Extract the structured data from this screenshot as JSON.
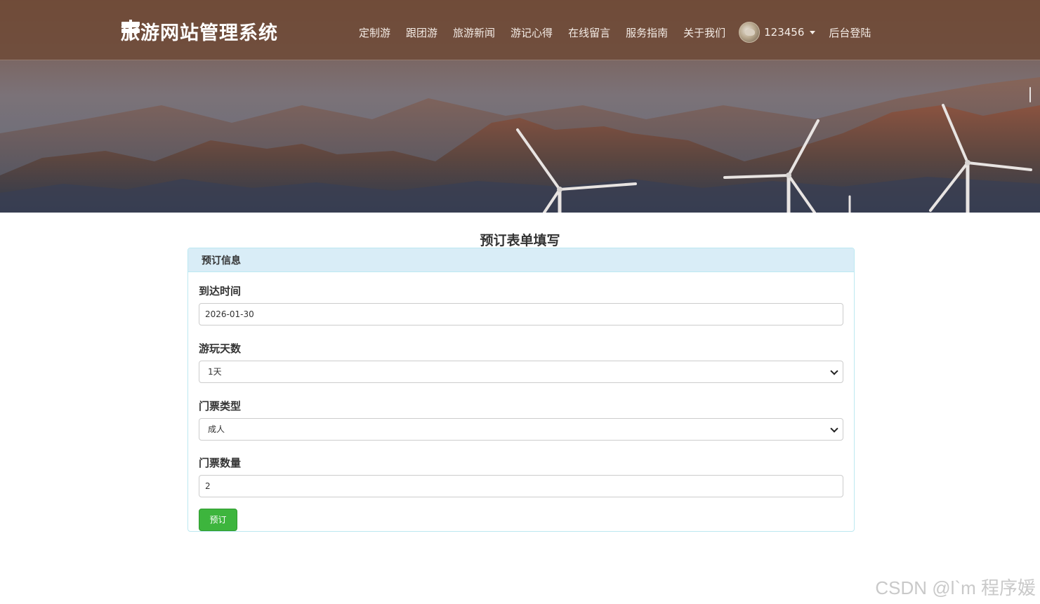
{
  "header": {
    "brand_title": "旅游网站管理系统",
    "brand_icon": "signpost-icon",
    "nav_items": [
      "定制游",
      "跟团游",
      "旅游新闻",
      "游记心得",
      "在线留言",
      "服务指南",
      "关于我们"
    ],
    "user": {
      "name": "123456",
      "avatar": "cat-avatar"
    },
    "admin_login": "后台登陆"
  },
  "main": {
    "page_title": "预订表单填写",
    "panel_title": "预订信息",
    "fields": {
      "arrival_label": "到达时间",
      "arrival_value": "2026-01-30",
      "days_label": "游玩天数",
      "days_value": "1天",
      "ticket_type_label": "门票类型",
      "ticket_type_value": "成人",
      "ticket_qty_label": "门票数量",
      "ticket_qty_value": "2"
    },
    "submit_label": "预订"
  },
  "watermark": "CSDN @l`m 程序媛",
  "colors": {
    "panel_border": "#bce8f1",
    "panel_heading_bg": "#d9edf7",
    "submit_bg": "#3db53d",
    "navbar_bg": "#6e4a37"
  }
}
